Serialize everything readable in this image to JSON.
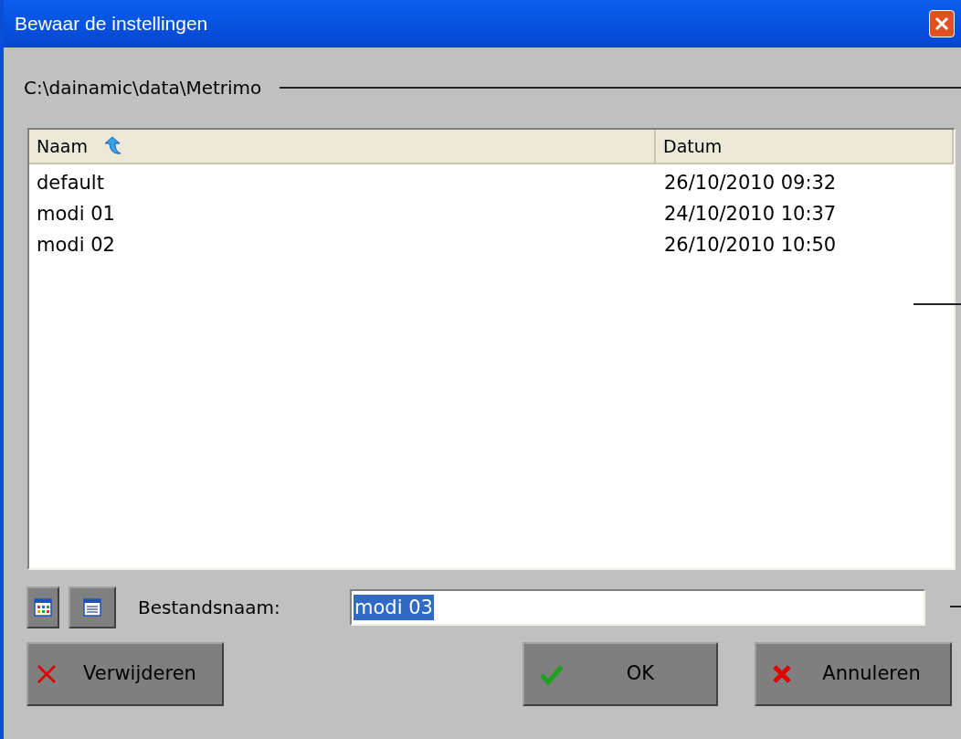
{
  "window": {
    "title": "Bewaar de instellingen"
  },
  "path": "C:\\dainamic\\data\\Metrimo",
  "table": {
    "columns": [
      {
        "label": "Naam",
        "sorted": true
      },
      {
        "label": "Datum",
        "sorted": false
      }
    ],
    "rows": [
      {
        "name": "default",
        "date": "26/10/2010 09:32"
      },
      {
        "name": "modi 01",
        "date": "24/10/2010 10:37"
      },
      {
        "name": "modi 02",
        "date": "26/10/2010 10:50"
      }
    ]
  },
  "filename": {
    "label": "Bestandsnaam:",
    "value": "modi 03",
    "selected": true
  },
  "buttons": [
    {
      "kind": "delete",
      "label": "Verwijderen"
    },
    {
      "kind": "ok",
      "label": "OK"
    },
    {
      "kind": "cancel",
      "label": "Annuleren"
    }
  ]
}
